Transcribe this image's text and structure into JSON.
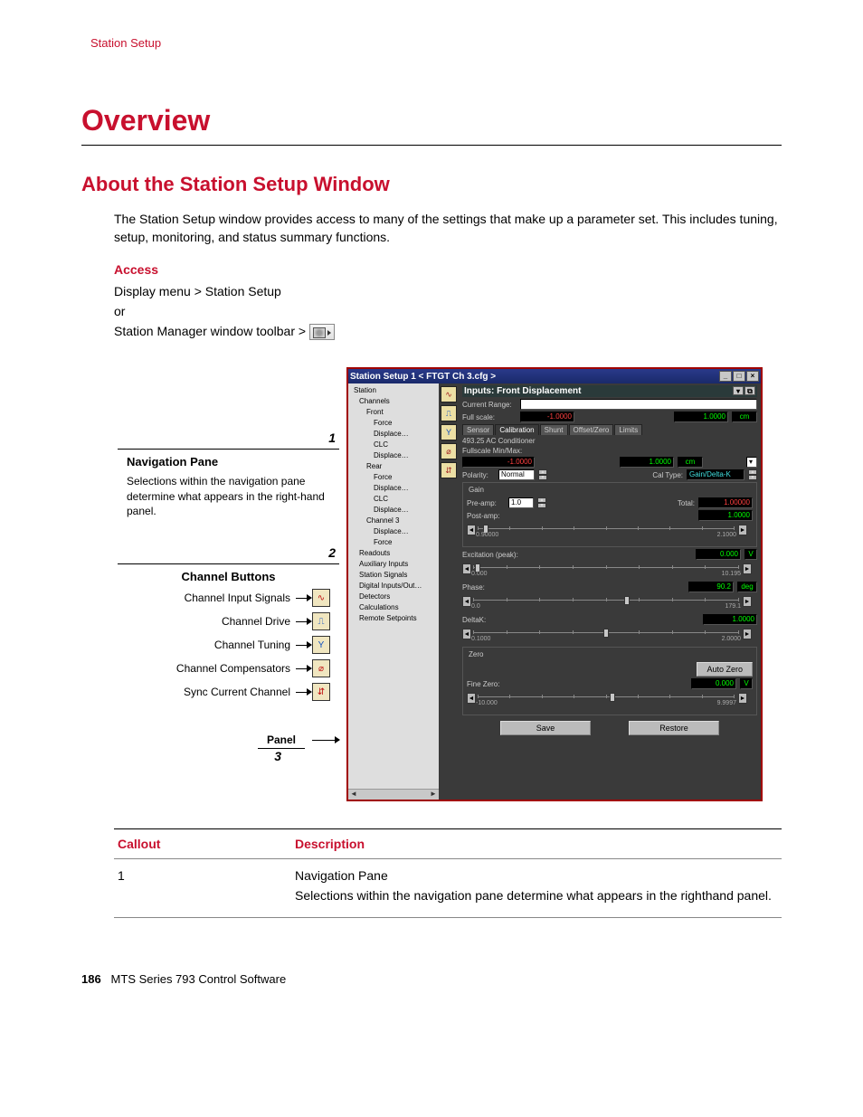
{
  "running_head": "Station Setup",
  "h1": "Overview",
  "h2": "About the Station Setup Window",
  "intro": "The Station Setup window provides access to many of the settings that make up a parameter set. This includes tuning, setup, monitoring, and status summary functions.",
  "access_label": "Access",
  "access_line1": "Display menu > Station Setup",
  "access_or": "or",
  "access_line2": "Station Manager window toolbar >",
  "annotations": {
    "num1": "1",
    "nav_title": "Navigation Pane",
    "nav_text": "Selections within the navigation pane determine what appears in the right-hand panel.",
    "num2": "2",
    "ch_title": "Channel Buttons",
    "rows": {
      "r1": "Channel Input Signals",
      "r2": "Channel Drive",
      "r3": "Channel Tuning",
      "r4": "Channel Compensators",
      "r5": "Sync Current Channel"
    },
    "panel_label": "Panel",
    "num3": "3"
  },
  "window": {
    "title": "Station Setup 1  < FTGT Ch 3.cfg >",
    "tree": [
      {
        "t": "Station",
        "lv": ""
      },
      {
        "t": "Channels",
        "lv": "l1"
      },
      {
        "t": "Front",
        "lv": "l2"
      },
      {
        "t": "Force",
        "lv": "l3"
      },
      {
        "t": "Displace…",
        "lv": "l3",
        "sel": true
      },
      {
        "t": "CLC",
        "lv": "l3"
      },
      {
        "t": "Displace…",
        "lv": "l3"
      },
      {
        "t": "Rear",
        "lv": "l2"
      },
      {
        "t": "Force",
        "lv": "l3"
      },
      {
        "t": "Displace…",
        "lv": "l3"
      },
      {
        "t": "CLC",
        "lv": "l3"
      },
      {
        "t": "Displace…",
        "lv": "l3"
      },
      {
        "t": "Channel 3",
        "lv": "l2"
      },
      {
        "t": "Displace…",
        "lv": "l3"
      },
      {
        "t": "Force",
        "lv": "l3"
      },
      {
        "t": "Readouts",
        "lv": "l1"
      },
      {
        "t": "Auxiliary Inputs",
        "lv": "l1"
      },
      {
        "t": "Station Signals",
        "lv": "l1"
      },
      {
        "t": "Digital Inputs/Out…",
        "lv": "l1"
      },
      {
        "t": "Detectors",
        "lv": "l1"
      },
      {
        "t": "Calculations",
        "lv": "l1"
      },
      {
        "t": "Remote Setpoints",
        "lv": "l1"
      }
    ],
    "panel_title": "Inputs: Front Displacement",
    "current_range": "Current Range:",
    "full_scale": "Full scale:",
    "full_lo": "-1.0000",
    "full_hi": "1.0000",
    "full_unit": "cm",
    "tabs": [
      "Sensor",
      "Calibration",
      "Shunt",
      "Offset/Zero",
      "Limits"
    ],
    "conditioner": "493.25 AC Conditioner",
    "fs_label": "Fullscale Min/Max:",
    "fs_lo": "-1.0000",
    "fs_hi": "1.0000",
    "fs_unit": "cm",
    "polarity_label": "Polarity:",
    "polarity_value": "Normal",
    "caltype_label": "Cal Type:",
    "caltype_value": "Gain/Delta-K",
    "gain_label": "Gain",
    "preamp_label": "Pre-amp:",
    "preamp_value": "1.0",
    "total_label": "Total:",
    "total_value": "1.00000",
    "postamp_label": "Post-amp:",
    "postamp_value": "1.0000",
    "postamp_min": "0.90000",
    "postamp_max": "2.1000",
    "excitation_label": "Excitation (peak):",
    "excitation_value": "0.000",
    "excitation_unit": "V",
    "excitation_min": "0.000",
    "excitation_max": "10.195",
    "phase_label": "Phase:",
    "phase_value": "90.2",
    "phase_unit": "deg",
    "phase_min": "0.0",
    "phase_max": "179.1",
    "deltak_label": "DeltaK:",
    "deltak_value": "1.0000",
    "deltak_min": "0.1000",
    "deltak_max": "2.0000",
    "zero_label": "Zero",
    "autozero_btn": "Auto Zero",
    "finezero_label": "Fine Zero:",
    "finezero_value": "0.000",
    "finezero_unit": "V",
    "finezero_min": "-10.000",
    "finezero_max": "9.9997",
    "save_btn": "Save",
    "restore_btn": "Restore"
  },
  "table": {
    "h1": "Callout",
    "h2": "Description",
    "r1c1": "1",
    "r1c2a": "Navigation Pane",
    "r1c2b": "Selections within the navigation pane determine what appears in the righthand panel."
  },
  "footer_page": "186",
  "footer_text": "MTS Series 793 Control Software"
}
